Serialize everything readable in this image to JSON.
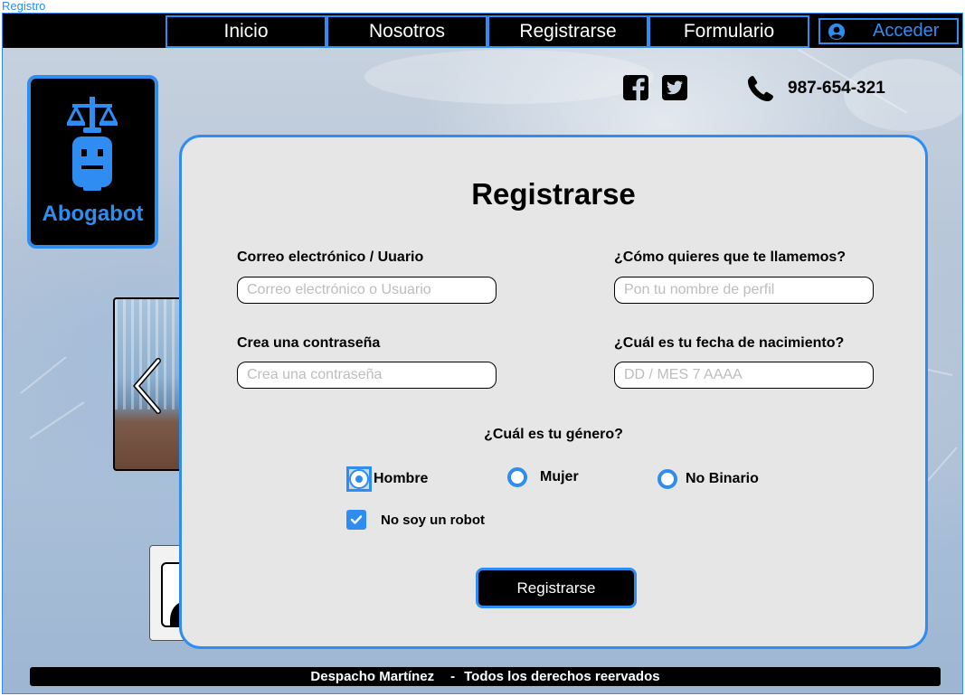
{
  "frame": {
    "label": "Registro"
  },
  "nav": {
    "items": [
      "Inicio",
      "Nosotros",
      "Registrarse",
      "Formulario"
    ],
    "login_label": "Acceder"
  },
  "brand": {
    "name": "Abogabot"
  },
  "contact": {
    "phone": "987-654-321"
  },
  "icons": {
    "logo": "scales-robot-icon",
    "facebook": "facebook-icon",
    "twitter": "twitter-icon",
    "phone": "phone-icon",
    "user": "user-circle-icon",
    "prev": "chevron-left-icon",
    "check": "check-icon"
  },
  "form": {
    "title": "Registrarse",
    "email": {
      "label": "Correo electrónico / Uuario",
      "placeholder": "Correo electrónico o Usuario"
    },
    "nickname": {
      "label": "¿Cómo quieres que te llamemos?",
      "placeholder": "Pon tu nombre de perfil"
    },
    "password": {
      "label": "Crea una contraseña",
      "placeholder": "Crea una contraseña"
    },
    "birthdate": {
      "label": "¿Cuál es tu fecha de nacimiento?",
      "placeholder": "DD / MES 7 AAAA"
    },
    "gender": {
      "question": "¿Cuál es tu género?",
      "options": [
        "Hombre",
        "Mujer",
        "No Binario"
      ],
      "selected": "Hombre"
    },
    "captcha": {
      "label": "No soy un robot",
      "checked": true
    },
    "submit_label": "Registrarse"
  },
  "footer": {
    "owner": "Despacho Martínez",
    "separator": "-",
    "rights": "Todos los derechos reervados"
  },
  "colors": {
    "accent": "#2f8df2",
    "nav_bg": "#000000",
    "panel_bg": "#e6e6e6"
  }
}
